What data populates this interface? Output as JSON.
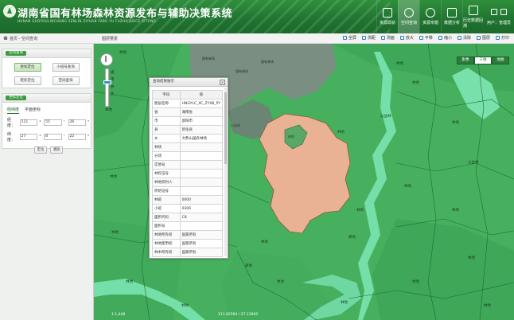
{
  "header": {
    "title": "湖南省国有林场森林资源发布与辅助决策系统",
    "subtitle": "HUNAN GUOYOULINCHANG SENLIN ZIYUAN FABU YU FUZHU JUECE XITONG",
    "nav": [
      {
        "label": "资源现状",
        "icon": "cube-icon"
      },
      {
        "label": "空间查询",
        "icon": "search-icon",
        "active": true
      },
      {
        "label": "资源专题",
        "icon": "tree-icon"
      },
      {
        "label": "数据分析",
        "icon": "chart-icon"
      },
      {
        "label": "历史数据回溯",
        "icon": "history-icon"
      }
    ],
    "user": {
      "label": "用户：管理员"
    }
  },
  "breadcrumb": {
    "path": "首页 - 空间查询",
    "overview_tab": "图层要素"
  },
  "toolbar": [
    {
      "label": "全屏",
      "icon": "fullscreen-icon"
    },
    {
      "label": "测距",
      "icon": "ruler-icon"
    },
    {
      "label": "测面",
      "icon": "area-icon"
    },
    {
      "label": "放大",
      "icon": "zoom-in-icon"
    },
    {
      "label": "平移",
      "icon": "pan-icon"
    },
    {
      "label": "缩小",
      "icon": "zoom-out-icon"
    },
    {
      "label": "清除",
      "icon": "clear-icon"
    },
    {
      "label": "图层",
      "icon": "layers-icon"
    },
    {
      "label": "打印",
      "icon": "print-icon"
    }
  ],
  "query_panel": {
    "title": "空间查询",
    "buttons": [
      {
        "label": "坐标定位",
        "active": true
      },
      {
        "label": "小班号查询"
      },
      {
        "label": "矩形定位"
      },
      {
        "label": "空间查询"
      }
    ]
  },
  "coord_panel": {
    "title": "坐标定位",
    "tabs": [
      {
        "label": "经纬度",
        "active": true
      },
      {
        "label": "平面坐标"
      }
    ],
    "longitude": {
      "label": "经度：",
      "deg": "111",
      "min": "55",
      "sec": "26"
    },
    "latitude": {
      "label": "纬度：",
      "deg": "27",
      "min": "8",
      "sec": "22"
    },
    "units": {
      "deg": "°",
      "min": "'",
      "sec": "\""
    },
    "buttons": [
      {
        "label": "定位"
      },
      {
        "label": "清除"
      }
    ]
  },
  "map": {
    "types": [
      {
        "label": "影像"
      },
      {
        "label": "三维",
        "active": true
      },
      {
        "label": "地图"
      }
    ],
    "zoom_labels": [
      "省",
      "市",
      "县",
      "乡"
    ],
    "labels_polygon": [
      "国有林场",
      "耕地",
      "林地",
      "公益林"
    ],
    "scale_text": "1:1,448",
    "coords_text": "111.92564 / 27.13902",
    "colors": {
      "forest": "#4fbd66",
      "dark_forest": "#3aa354",
      "grey": "#7e9186",
      "salmon": "#e9b294",
      "highlight": "#59a868",
      "water": "#6ed7a2",
      "label": "#173d1f"
    }
  },
  "popup": {
    "title": "查询结果展示",
    "columns": [
      "字段",
      "值"
    ],
    "rows": [
      [
        "图层名称",
        "HNGYLC_XC_ZYXB_PY"
      ],
      [
        "省",
        "湖南省"
      ],
      [
        "市",
        "邵阳市"
      ],
      [
        "县",
        "新化县"
      ],
      [
        "乡",
        "大熊山国有林场"
      ],
      [
        "林场",
        ""
      ],
      [
        "分场",
        ""
      ],
      [
        "实地号",
        ""
      ],
      [
        "林权证号",
        ""
      ],
      [
        "林地权利人",
        ""
      ],
      [
        "原始证号",
        ""
      ],
      [
        "林班",
        "0000"
      ],
      [
        "小班",
        "0306"
      ],
      [
        "面积代码",
        "C8"
      ],
      [
        "面积号",
        ""
      ],
      [
        "林地所有权",
        "国家所有"
      ],
      [
        "林地使用权",
        "国家所有"
      ],
      [
        "林木所有权",
        "国家所有"
      ]
    ]
  }
}
